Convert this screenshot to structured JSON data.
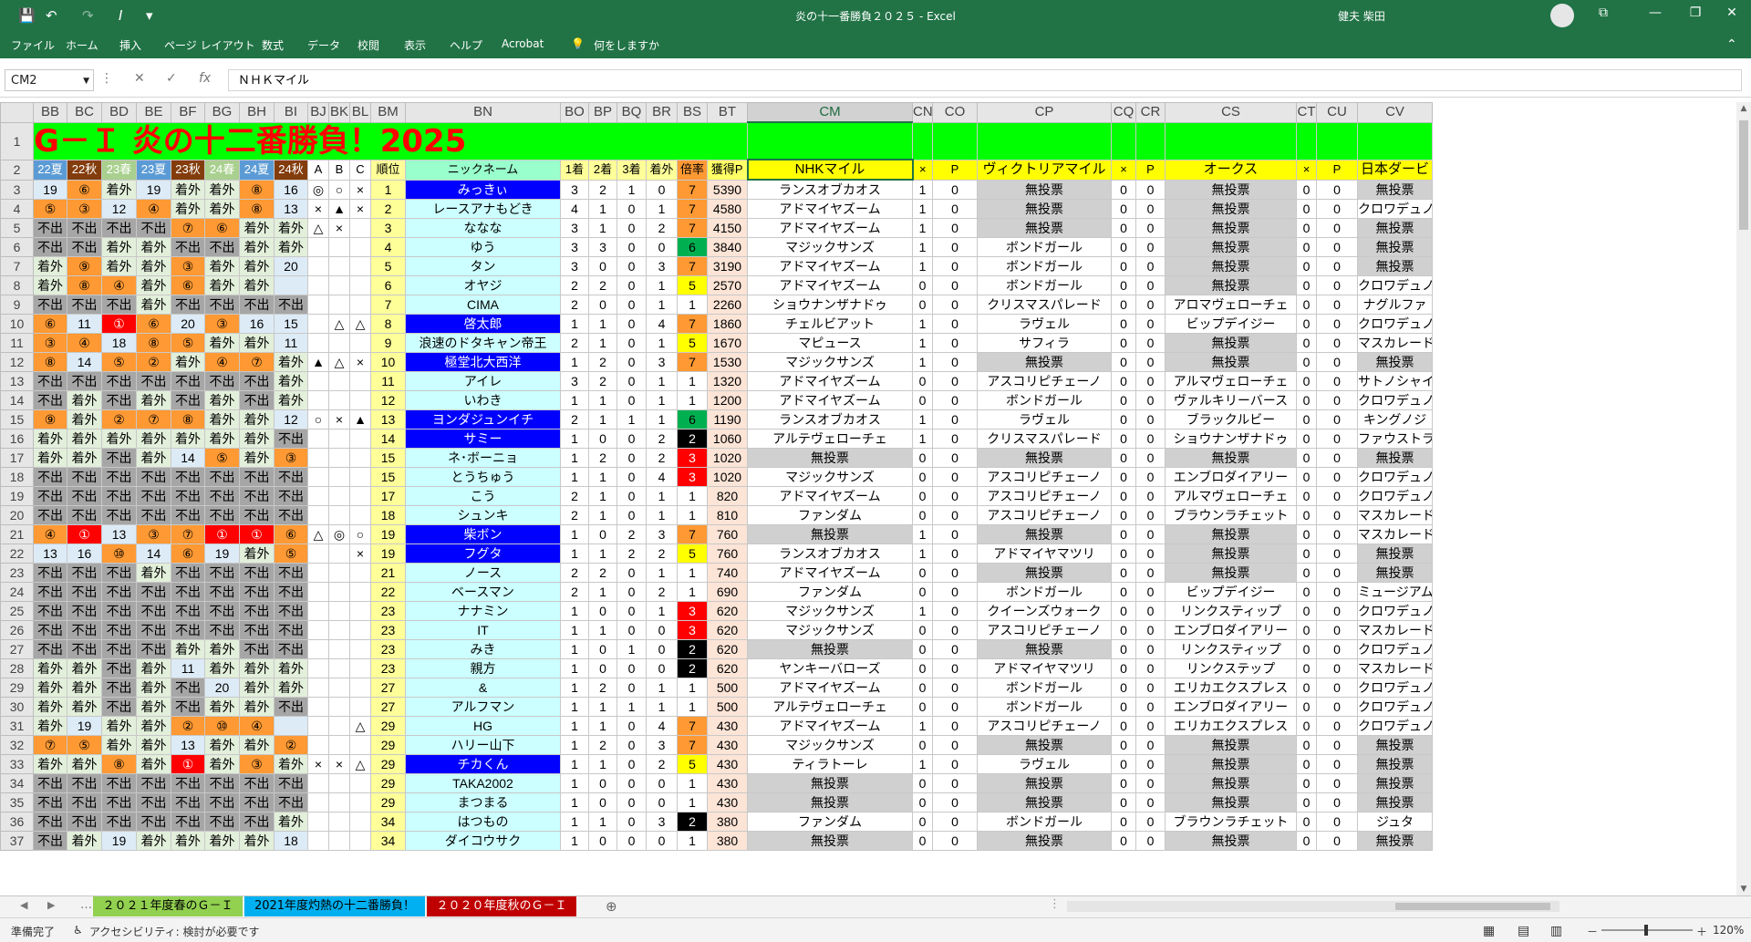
{
  "app": {
    "title": "炎の十一番勝負２０２５  -  Excel",
    "user": "健夫 柴田",
    "qa": {
      "save": "💾",
      "undo": "↶",
      "redo": "↷",
      "italic": "I",
      "more": "▾"
    },
    "win": {
      "ribbon": "⧉",
      "min": "—",
      "max": "❐",
      "close": "✕"
    }
  },
  "menu": [
    "ファイル",
    "ホーム",
    "挿入",
    "ページ レイアウト",
    "数式",
    "データ",
    "校閲",
    "表示",
    "ヘルプ",
    "Acrobat",
    "何をしますか"
  ],
  "namebox": "CM2",
  "formula": "ＮＨＫマイル",
  "fxicons": {
    "cancel": "✕",
    "enter": "✓",
    "fx": "fx"
  },
  "columns": [
    "BB",
    "BC",
    "BD",
    "BE",
    "BF",
    "BG",
    "BH",
    "BI",
    "BJ",
    "BK",
    "BL",
    "BM",
    "BN",
    "BO",
    "BP",
    "BQ",
    "BR",
    "BS",
    "BT",
    "CM",
    "CN",
    "CO",
    "CP",
    "CQ",
    "CR",
    "CS",
    "CT",
    "CU",
    "CV"
  ],
  "title_cell": "G－Ｉ 炎の十二番勝負！2025",
  "header_row": [
    "22夏",
    "22秋",
    "23春",
    "23夏",
    "23秋",
    "24春",
    "24夏",
    "24秋",
    "A",
    "B",
    "C",
    "順位",
    "ニックネーム",
    "1着",
    "2着",
    "3着",
    "着外",
    "倍率",
    "獲得P",
    "NHKマイル",
    "×",
    "P",
    "ヴィクトリアマイル",
    "×",
    "P",
    "オークス",
    "×",
    "P",
    "日本ダービ"
  ],
  "rows": [
    {
      "n": "3",
      "c": [
        "19",
        "⑥",
        "着外",
        "19",
        "着外",
        "着外",
        "⑧",
        "16",
        "◎",
        "○",
        "×",
        "1",
        "みっきぃ",
        "3",
        "2",
        "1",
        "0",
        "7",
        "5390",
        "ランスオブカオス",
        "1",
        "0",
        "無投票",
        "0",
        "0",
        "無投票",
        "0",
        "0",
        "無投票"
      ]
    },
    {
      "n": "4",
      "c": [
        "⑤",
        "③",
        "12",
        "④",
        "着外",
        "着外",
        "⑧",
        "13",
        "×",
        "▲",
        "×",
        "2",
        "レースアナもどき",
        "4",
        "1",
        "0",
        "1",
        "7",
        "4580",
        "アドマイヤズーム",
        "1",
        "0",
        "無投票",
        "0",
        "0",
        "無投票",
        "0",
        "0",
        "クロワデュノ"
      ]
    },
    {
      "n": "5",
      "c": [
        "不出",
        "不出",
        "不出",
        "不出",
        "⑦",
        "⑥",
        "着外",
        "着外",
        "△",
        "×",
        "",
        "3",
        "ななな",
        "3",
        "1",
        "0",
        "2",
        "7",
        "4150",
        "アドマイヤズーム",
        "1",
        "0",
        "無投票",
        "0",
        "0",
        "無投票",
        "0",
        "0",
        "無投票"
      ]
    },
    {
      "n": "6",
      "c": [
        "不出",
        "不出",
        "着外",
        "着外",
        "不出",
        "不出",
        "着外",
        "着外",
        "",
        "",
        "",
        "4",
        "ゆう",
        "3",
        "3",
        "0",
        "0",
        "6",
        "3840",
        "マジックサンズ",
        "1",
        "0",
        "ボンドガール",
        "0",
        "0",
        "無投票",
        "0",
        "0",
        "無投票"
      ]
    },
    {
      "n": "7",
      "c": [
        "着外",
        "⑨",
        "着外",
        "着外",
        "③",
        "着外",
        "着外",
        "20",
        "",
        "",
        "",
        "5",
        "タン",
        "3",
        "0",
        "0",
        "3",
        "7",
        "3190",
        "アドマイヤズーム",
        "1",
        "0",
        "ボンドガール",
        "0",
        "0",
        "無投票",
        "0",
        "0",
        "無投票"
      ]
    },
    {
      "n": "8",
      "c": [
        "着外",
        "⑧",
        "④",
        "着外",
        "⑥",
        "着外",
        "着外",
        "",
        "",
        "",
        "",
        "6",
        "オヤジ",
        "2",
        "2",
        "0",
        "1",
        "5",
        "2570",
        "アドマイヤズーム",
        "0",
        "0",
        "ボンドガール",
        "0",
        "0",
        "無投票",
        "0",
        "0",
        "クロワデュノ"
      ]
    },
    {
      "n": "9",
      "c": [
        "不出",
        "不出",
        "不出",
        "着外",
        "不出",
        "不出",
        "不出",
        "不出",
        "",
        "",
        "",
        "7",
        "CIMA",
        "2",
        "0",
        "0",
        "1",
        "1",
        "2260",
        "ショウナンザナドゥ",
        "0",
        "0",
        "クリスマスパレード",
        "0",
        "0",
        "アロマヴェローチェ",
        "0",
        "0",
        "ナグルファ"
      ]
    },
    {
      "n": "10",
      "c": [
        "⑥",
        "11",
        "①",
        "⑥",
        "20",
        "③",
        "16",
        "15",
        "",
        "△",
        "△",
        "8",
        "啓太郎",
        "1",
        "1",
        "0",
        "4",
        "7",
        "1860",
        "チェルビアット",
        "1",
        "0",
        "ラヴェル",
        "0",
        "0",
        "ビップデイジー",
        "0",
        "0",
        "クロワデュノ"
      ]
    },
    {
      "n": "11",
      "c": [
        "③",
        "④",
        "18",
        "⑧",
        "⑤",
        "着外",
        "着外",
        "11",
        "",
        "",
        "",
        "9",
        "浪速のドタキャン帝王",
        "2",
        "1",
        "0",
        "1",
        "5",
        "1670",
        "マピュース",
        "1",
        "0",
        "サフィラ",
        "0",
        "0",
        "無投票",
        "0",
        "0",
        "マスカレード"
      ]
    },
    {
      "n": "12",
      "c": [
        "⑧",
        "14",
        "⑤",
        "②",
        "着外",
        "④",
        "⑦",
        "着外",
        "▲",
        "△",
        "×",
        "10",
        "極堂北大西洋",
        "1",
        "2",
        "0",
        "3",
        "7",
        "1530",
        "マジックサンズ",
        "1",
        "0",
        "無投票",
        "0",
        "0",
        "無投票",
        "0",
        "0",
        "無投票"
      ]
    },
    {
      "n": "13",
      "c": [
        "不出",
        "不出",
        "不出",
        "不出",
        "不出",
        "不出",
        "不出",
        "着外",
        "",
        "",
        "",
        "11",
        "アイレ",
        "3",
        "2",
        "0",
        "1",
        "1",
        "1320",
        "アドマイヤズーム",
        "0",
        "0",
        "アスコリピチェーノ",
        "0",
        "0",
        "アルマヴェローチェ",
        "0",
        "0",
        "サトノシャイニ"
      ]
    },
    {
      "n": "14",
      "c": [
        "不出",
        "着外",
        "不出",
        "着外",
        "不出",
        "着外",
        "不出",
        "着外",
        "",
        "",
        "",
        "12",
        "いわき",
        "1",
        "1",
        "0",
        "1",
        "1",
        "1200",
        "アドマイヤズーム",
        "0",
        "0",
        "ボンドガール",
        "0",
        "0",
        "ヴァルキリーバース",
        "0",
        "0",
        "クロワデュノ"
      ]
    },
    {
      "n": "15",
      "c": [
        "⑨",
        "着外",
        "②",
        "⑦",
        "⑧",
        "着外",
        "着外",
        "12",
        "○",
        "×",
        "▲",
        "13",
        "ヨンダジュンイチ",
        "2",
        "1",
        "1",
        "1",
        "6",
        "1190",
        "ランスオブカオス",
        "1",
        "0",
        "ラヴェル",
        "0",
        "0",
        "ブラックルビー",
        "0",
        "0",
        "キングノジ"
      ]
    },
    {
      "n": "16",
      "c": [
        "着外",
        "着外",
        "着外",
        "着外",
        "着外",
        "着外",
        "着外",
        "不出",
        "",
        "",
        "",
        "14",
        "サミー",
        "1",
        "0",
        "0",
        "2",
        "2",
        "1060",
        "アルテヴェローチェ",
        "1",
        "0",
        "クリスマスパレード",
        "0",
        "0",
        "ショウナンザナドゥ",
        "0",
        "0",
        "ファウストラー"
      ]
    },
    {
      "n": "17",
      "c": [
        "着外",
        "着外",
        "不出",
        "着外",
        "14",
        "⑤",
        "着外",
        "③",
        "",
        "",
        "",
        "15",
        "ネ･ボーニョ",
        "1",
        "2",
        "0",
        "2",
        "3",
        "1020",
        "無投票",
        "0",
        "0",
        "無投票",
        "0",
        "0",
        "無投票",
        "0",
        "0",
        "無投票"
      ]
    },
    {
      "n": "18",
      "c": [
        "不出",
        "不出",
        "不出",
        "不出",
        "不出",
        "不出",
        "不出",
        "不出",
        "",
        "",
        "",
        "15",
        "とうちゅう",
        "1",
        "1",
        "0",
        "4",
        "3",
        "1020",
        "マジックサンズ",
        "0",
        "0",
        "アスコリピチェーノ",
        "0",
        "0",
        "エンブロダイアリー",
        "0",
        "0",
        "クロワデュノ"
      ]
    },
    {
      "n": "19",
      "c": [
        "不出",
        "不出",
        "不出",
        "不出",
        "不出",
        "不出",
        "不出",
        "不出",
        "",
        "",
        "",
        "17",
        "こう",
        "2",
        "1",
        "0",
        "1",
        "1",
        "820",
        "アドマイヤズーム",
        "0",
        "0",
        "アスコリピチェーノ",
        "0",
        "0",
        "アルマヴェローチェ",
        "0",
        "0",
        "クロワデュノ"
      ]
    },
    {
      "n": "20",
      "c": [
        "不出",
        "不出",
        "不出",
        "不出",
        "不出",
        "不出",
        "不出",
        "不出",
        "",
        "",
        "",
        "18",
        "シュンキ",
        "2",
        "1",
        "0",
        "1",
        "1",
        "810",
        "ファンダム",
        "0",
        "0",
        "アスコリピチェーノ",
        "0",
        "0",
        "ブラウンラチェット",
        "0",
        "0",
        "マスカレード"
      ]
    },
    {
      "n": "21",
      "c": [
        "④",
        "①",
        "13",
        "③",
        "⑦",
        "①",
        "①",
        "⑥",
        "△",
        "◎",
        "○",
        "19",
        "柴ボン",
        "1",
        "0",
        "2",
        "3",
        "7",
        "760",
        "無投票",
        "1",
        "0",
        "無投票",
        "0",
        "0",
        "無投票",
        "0",
        "0",
        "マスカレード"
      ]
    },
    {
      "n": "22",
      "c": [
        "13",
        "16",
        "⑩",
        "14",
        "⑥",
        "19",
        "着外",
        "⑤",
        "",
        "",
        "×",
        "19",
        "フグタ",
        "1",
        "1",
        "2",
        "2",
        "5",
        "760",
        "ランスオブカオス",
        "1",
        "0",
        "アドマイヤマツリ",
        "0",
        "0",
        "無投票",
        "0",
        "0",
        "無投票"
      ]
    },
    {
      "n": "23",
      "c": [
        "不出",
        "不出",
        "不出",
        "着外",
        "不出",
        "不出",
        "不出",
        "不出",
        "",
        "",
        "",
        "21",
        "ノース",
        "2",
        "2",
        "0",
        "1",
        "1",
        "740",
        "アドマイヤズーム",
        "0",
        "0",
        "無投票",
        "0",
        "0",
        "無投票",
        "0",
        "0",
        "無投票"
      ]
    },
    {
      "n": "24",
      "c": [
        "不出",
        "不出",
        "不出",
        "不出",
        "不出",
        "不出",
        "不出",
        "不出",
        "",
        "",
        "",
        "22",
        "ベースマン",
        "2",
        "1",
        "0",
        "2",
        "1",
        "690",
        "ファンダム",
        "0",
        "0",
        "ボンドガール",
        "0",
        "0",
        "ビップデイジー",
        "0",
        "0",
        "ミュージアムマ"
      ]
    },
    {
      "n": "25",
      "c": [
        "不出",
        "不出",
        "不出",
        "不出",
        "不出",
        "不出",
        "不出",
        "不出",
        "",
        "",
        "",
        "23",
        "ナナミン",
        "1",
        "0",
        "0",
        "1",
        "3",
        "620",
        "マジックサンズ",
        "1",
        "0",
        "クイーンズウォーク",
        "0",
        "0",
        "リンクスティップ",
        "0",
        "0",
        "クロワデュノ"
      ]
    },
    {
      "n": "26",
      "c": [
        "不出",
        "不出",
        "不出",
        "不出",
        "不出",
        "不出",
        "不出",
        "不出",
        "",
        "",
        "",
        "23",
        "IT",
        "1",
        "1",
        "0",
        "0",
        "3",
        "620",
        "マジックサンズ",
        "0",
        "0",
        "アスコリピチェーノ",
        "0",
        "0",
        "エンブロダイアリー",
        "0",
        "0",
        "マスカレード"
      ]
    },
    {
      "n": "27",
      "c": [
        "不出",
        "不出",
        "不出",
        "不出",
        "着外",
        "着外",
        "不出",
        "不出",
        "",
        "",
        "",
        "23",
        "みき",
        "1",
        "0",
        "1",
        "0",
        "2",
        "620",
        "無投票",
        "0",
        "0",
        "無投票",
        "0",
        "0",
        "リンクスティップ",
        "0",
        "0",
        "クロワデュノ"
      ]
    },
    {
      "n": "28",
      "c": [
        "着外",
        "着外",
        "不出",
        "着外",
        "11",
        "着外",
        "着外",
        "着外",
        "",
        "",
        "",
        "23",
        "親方",
        "1",
        "0",
        "0",
        "0",
        "2",
        "620",
        "ヤンキーバローズ",
        "0",
        "0",
        "アドマイヤマツリ",
        "0",
        "0",
        "リンクステップ",
        "0",
        "0",
        "マスカレード"
      ]
    },
    {
      "n": "29",
      "c": [
        "着外",
        "着外",
        "不出",
        "着外",
        "不出",
        "20",
        "着外",
        "着外",
        "",
        "",
        "",
        "27",
        "&",
        "1",
        "2",
        "0",
        "1",
        "1",
        "500",
        "アドマイヤズーム",
        "0",
        "0",
        "ボンドガール",
        "0",
        "0",
        "エリカエクスプレス",
        "0",
        "0",
        "クロワデュノ"
      ]
    },
    {
      "n": "30",
      "c": [
        "着外",
        "着外",
        "不出",
        "着外",
        "不出",
        "着外",
        "着外",
        "不出",
        "",
        "",
        "",
        "27",
        "アルフマン",
        "1",
        "1",
        "1",
        "1",
        "1",
        "500",
        "アルテヴェローチェ",
        "0",
        "0",
        "ボンドガール",
        "0",
        "0",
        "エンブロダイアリー",
        "0",
        "0",
        "クロワデュノ"
      ]
    },
    {
      "n": "31",
      "c": [
        "着外",
        "19",
        "着外",
        "着外",
        "②",
        "⑩",
        "④",
        "",
        "",
        "",
        "△",
        "29",
        "HG",
        "1",
        "1",
        "0",
        "4",
        "7",
        "430",
        "アドマイヤズーム",
        "1",
        "0",
        "アスコリピチェーノ",
        "0",
        "0",
        "エリカエクスプレス",
        "0",
        "0",
        "クロワデュノ"
      ]
    },
    {
      "n": "32",
      "c": [
        "⑦",
        "⑤",
        "着外",
        "着外",
        "13",
        "着外",
        "着外",
        "②",
        "",
        "",
        "",
        "29",
        "ハリー山下",
        "1",
        "2",
        "0",
        "3",
        "7",
        "430",
        "マジックサンズ",
        "0",
        "0",
        "無投票",
        "0",
        "0",
        "無投票",
        "0",
        "0",
        "無投票"
      ]
    },
    {
      "n": "33",
      "c": [
        "着外",
        "着外",
        "⑧",
        "着外",
        "①",
        "着外",
        "③",
        "着外",
        "×",
        "×",
        "△",
        "29",
        "チカくん",
        "1",
        "1",
        "0",
        "2",
        "5",
        "430",
        "ティラトーレ",
        "1",
        "0",
        "ラヴェル",
        "0",
        "0",
        "無投票",
        "0",
        "0",
        "無投票"
      ]
    },
    {
      "n": "34",
      "c": [
        "不出",
        "不出",
        "不出",
        "不出",
        "不出",
        "不出",
        "不出",
        "不出",
        "",
        "",
        "",
        "29",
        "TAKA2002",
        "1",
        "0",
        "0",
        "0",
        "1",
        "430",
        "無投票",
        "0",
        "0",
        "無投票",
        "0",
        "0",
        "無投票",
        "0",
        "0",
        "無投票"
      ]
    },
    {
      "n": "35",
      "c": [
        "不出",
        "不出",
        "不出",
        "不出",
        "不出",
        "不出",
        "不出",
        "不出",
        "",
        "",
        "",
        "29",
        "まつまる",
        "1",
        "0",
        "0",
        "0",
        "1",
        "430",
        "無投票",
        "0",
        "0",
        "無投票",
        "0",
        "0",
        "無投票",
        "0",
        "0",
        "無投票"
      ]
    },
    {
      "n": "36",
      "c": [
        "不出",
        "不出",
        "不出",
        "不出",
        "不出",
        "不出",
        "不出",
        "着外",
        "",
        "",
        "",
        "34",
        "はつもの",
        "1",
        "1",
        "0",
        "3",
        "2",
        "380",
        "ファンダム",
        "0",
        "0",
        "ボンドガール",
        "0",
        "0",
        "ブラウンラチェット",
        "0",
        "0",
        "ジュタ"
      ]
    },
    {
      "n": "37",
      "c": [
        "不出",
        "着外",
        "19",
        "着外",
        "着外",
        "着外",
        "着外",
        "18",
        "",
        "",
        "",
        "34",
        "ダイコウサク",
        "1",
        "0",
        "0",
        "0",
        "1",
        "380",
        "無投票",
        "0",
        "0",
        "無投票",
        "0",
        "0",
        "無投票",
        "0",
        "0",
        "無投票"
      ]
    }
  ],
  "tabs": [
    "２０２１年度春のＧ－Ｉ",
    "2021年度灼熱の十二番勝負！",
    "２０２０年度秋のＧ－Ｉ"
  ],
  "tab_colors": [
    "#92d050",
    "#00b0f0",
    "#c00000"
  ],
  "status": {
    "ready": "準備完了",
    "accessibility": "アクセシビリティ: 検討が必要です",
    "zoom": "120%"
  }
}
